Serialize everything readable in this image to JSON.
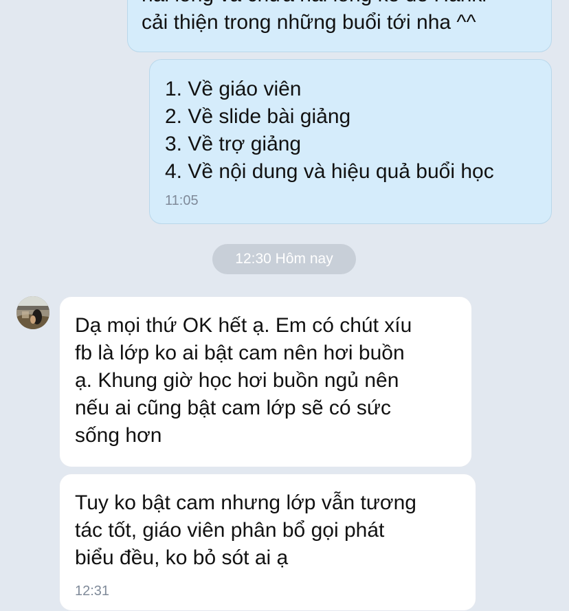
{
  "conversation": {
    "outgoing_top": {
      "lines": [
        "hài lòng và chưa hài lòng kể để Hanki",
        "cải thiện trong những buổi tới nha ^^"
      ]
    },
    "outgoing_list": {
      "lines": [
        "1. Về giáo viên",
        "2. Về slide bài giảng",
        "3. Về trợ giảng",
        "4. Về nội dung và hiệu quả buổi học"
      ],
      "time": "11:05"
    },
    "date_divider": "12:30 Hôm nay",
    "incoming_1": {
      "lines": [
        "Dạ mọi thứ OK hết ạ. Em có chút xíu",
        "fb là lớp ko ai bật cam nên hơi buồn",
        "ạ. Khung giờ học hơi buồn ngủ nên",
        "nếu ai cũng bật cam lớp sẽ có sức",
        "sống hơn"
      ]
    },
    "incoming_2": {
      "lines": [
        "Tuy ko bật cam nhưng lớp vẫn tương",
        "tác tốt, giáo viên phân bổ gọi phát",
        "biểu đều, ko bỏ sót ai ạ"
      ],
      "time": "12:31"
    }
  },
  "colors": {
    "background": "#e2e8f0",
    "outgoing_bubble": "#d5ecfb",
    "incoming_bubble": "#ffffff",
    "divider_pill": "#c8cfd8",
    "timestamp": "#7f8a99"
  },
  "icons": {
    "avatar": "user-avatar-photo"
  }
}
